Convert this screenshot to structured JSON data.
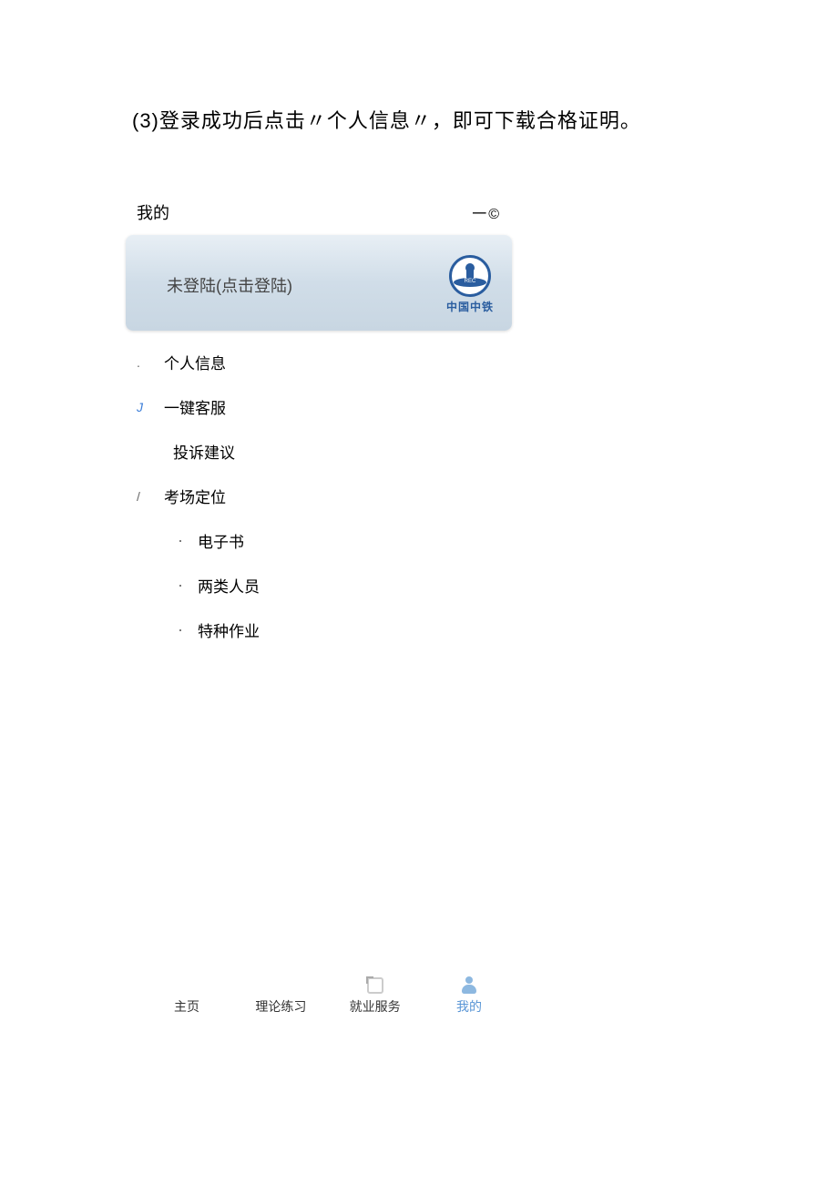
{
  "instruction": "(3)登录成功后点击〃个人信息〃，即可下载合格证明。",
  "header": {
    "title": "我的",
    "rightSymbol": "一©"
  },
  "loginCard": {
    "text": "未登陆(点击登陆)",
    "logoBand": "REC",
    "logoText": "中国中铁"
  },
  "menu": {
    "personalInfo": {
      "icon": ".",
      "label": "个人信息"
    },
    "customerService": {
      "icon": "J",
      "label": "一键客服"
    },
    "feedback": {
      "label": "投诉建议"
    },
    "examLocation": {
      "icon": "/",
      "label": "考场定位"
    },
    "ebook": {
      "icon": "·",
      "label": "电子书"
    },
    "twoTypes": {
      "icon": "·",
      "label": "两类人员"
    },
    "specialWork": {
      "icon": "·",
      "label": "特种作业"
    }
  },
  "bottomNav": {
    "home": "主页",
    "theory": "理论练习",
    "employment": "就业服务",
    "mine": "我的"
  }
}
